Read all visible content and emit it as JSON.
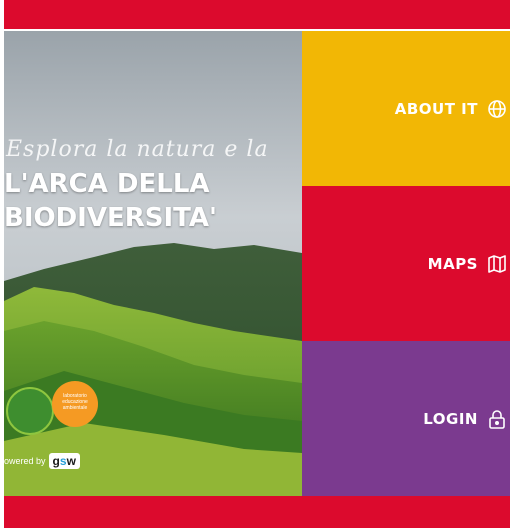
{
  "colors": {
    "brand_red": "#dc0a2d",
    "about_yellow": "#f2b705",
    "maps_red": "#dc0a2d",
    "login_purple": "#7b3a8f"
  },
  "hero": {
    "script_text": "Esplora la natura e la",
    "title": "L'ARCA DELLA\nBIODIVERSITA'",
    "orange_logo_text": "laboratorio educazione ambientale",
    "powered_by": "owered by",
    "partner_logo": {
      "prefix": "g",
      "highlight": "s",
      "suffix": "w"
    }
  },
  "menu": {
    "about": {
      "label": "ABOUT IT",
      "icon": "globe-icon"
    },
    "maps": {
      "label": "MAPS",
      "icon": "map-icon"
    },
    "login": {
      "label": "LOGIN",
      "icon": "lock-icon"
    }
  }
}
